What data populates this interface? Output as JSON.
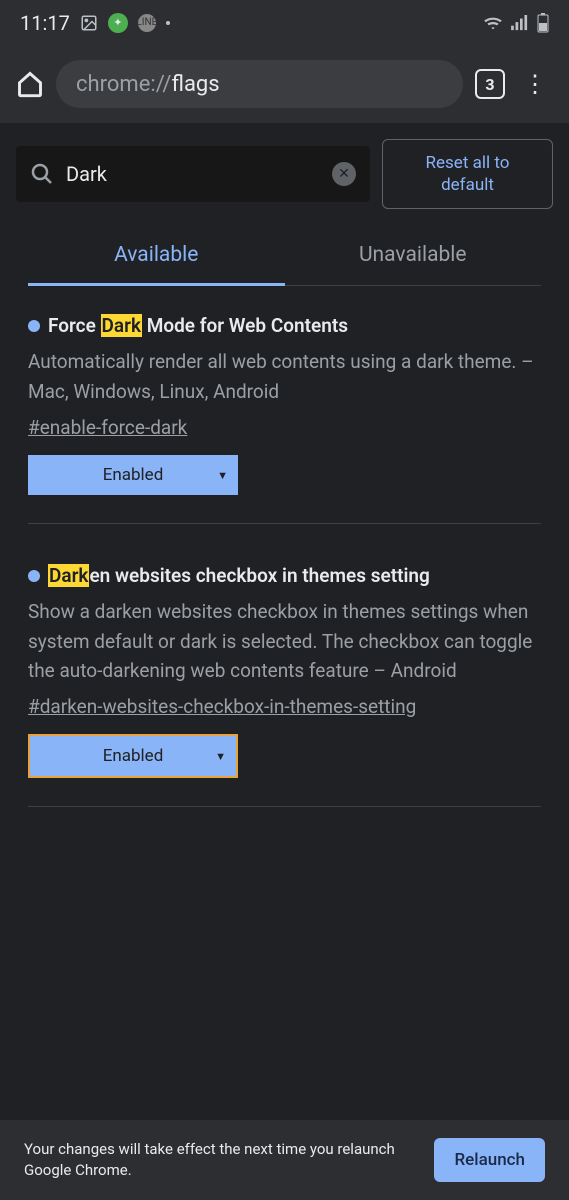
{
  "status": {
    "time": "11:17"
  },
  "browser": {
    "url_prefix": "chrome://",
    "url_path": "flags",
    "tab_count": "3"
  },
  "search": {
    "value": "Dark",
    "reset_label": "Reset all to default"
  },
  "tabs": {
    "available": "Available",
    "unavailable": "Unavailable"
  },
  "flags": [
    {
      "title_pre": "Force ",
      "title_hl": "Dark",
      "title_post": " Mode for Web Contents",
      "desc": "Automatically render all web contents using a dark theme. – Mac, Windows, Linux, Android",
      "hash": "#enable-force-dark",
      "selected": "Enabled",
      "outlined": false
    },
    {
      "title_pre": "",
      "title_hl": "Dark",
      "title_post": "en websites checkbox in themes setting",
      "desc": "Show a darken websites checkbox in themes settings when system default or dark is selected. The checkbox can toggle the auto-darkening web contents feature – Android",
      "hash": "#darken-websites-checkbox-in-themes-setting",
      "selected": "Enabled",
      "outlined": true
    }
  ],
  "relaunch": {
    "text": "Your changes will take effect the next time you relaunch Google Chrome.",
    "button": "Relaunch"
  }
}
